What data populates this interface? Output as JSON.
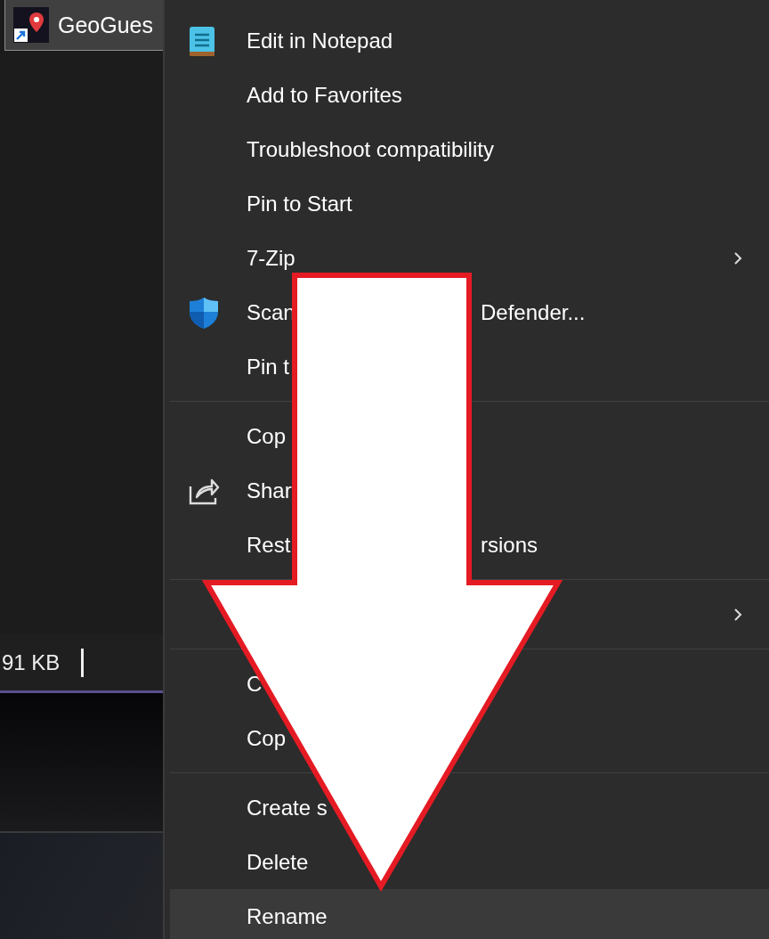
{
  "file": {
    "name": "GeoGues",
    "selected": true
  },
  "status": {
    "size": "91 KB"
  },
  "menu": {
    "groups": [
      [
        {
          "kind": "notepad",
          "label": "Edit in Notepad",
          "submenu": false,
          "selected": false
        },
        {
          "kind": "plain",
          "label": "Add to Favorites",
          "submenu": false,
          "selected": false
        },
        {
          "kind": "plain",
          "label": "Troubleshoot compatibility",
          "submenu": false,
          "selected": false
        },
        {
          "kind": "plain",
          "label": "Pin to Start",
          "submenu": false,
          "selected": false
        },
        {
          "kind": "plain",
          "label": "7-Zip",
          "submenu": true,
          "selected": false
        },
        {
          "kind": "shield",
          "label": "Scan",
          "tail": "Defender...",
          "submenu": false,
          "selected": false
        },
        {
          "kind": "plain",
          "label": "Pin t",
          "submenu": false,
          "selected": false
        }
      ],
      [
        {
          "kind": "plain",
          "label": "Cop",
          "submenu": false,
          "selected": false
        },
        {
          "kind": "share",
          "label": "Shar",
          "submenu": false,
          "selected": false
        },
        {
          "kind": "plain",
          "label": "Rest",
          "tail": "rsions",
          "submenu": false,
          "selected": false
        }
      ],
      [
        {
          "kind": "plain",
          "submenu": true,
          "selected": false
        }
      ],
      [
        {
          "kind": "plain",
          "label": "C",
          "submenu": false,
          "selected": false
        },
        {
          "kind": "plain",
          "label": "Cop",
          "submenu": false,
          "selected": false
        }
      ],
      [
        {
          "kind": "plain",
          "label": "Create s",
          "submenu": false,
          "selected": false
        },
        {
          "kind": "plain",
          "label": "Delete",
          "submenu": false,
          "selected": false
        },
        {
          "kind": "plain",
          "label": "Rename",
          "submenu": false,
          "selected": true
        }
      ]
    ]
  }
}
